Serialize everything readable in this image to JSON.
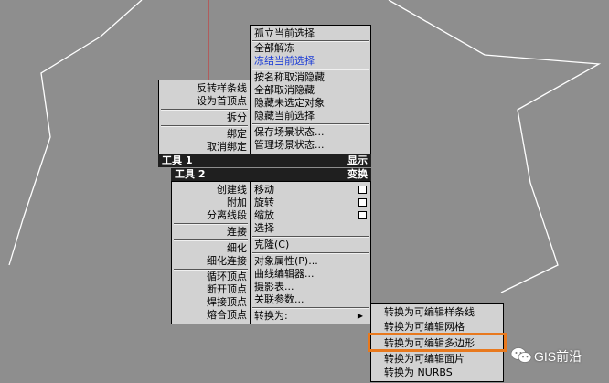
{
  "colors": {
    "viewport_bg": "#8e8e8e",
    "menu_bg": "#d2d2d2",
    "header_bg": "#1f1f1f",
    "header_text": "#ffffff",
    "highlight_text": "#1a3bd6",
    "emphasis_border": "#e8791e",
    "spline_line": "#ffffff",
    "axis_line": "#c83c3c"
  },
  "display_menu": {
    "items": [
      "孤立当前选择",
      "全部解冻",
      "冻结当前选择",
      "按名称取消隐藏",
      "全部取消隐藏",
      "隐藏未选定对象",
      "隐藏当前选择",
      "保存场景状态...",
      "管理场景状态..."
    ]
  },
  "tools1_menu": {
    "items": [
      "反转样条线",
      "设为首顶点",
      "拆分",
      "绑定",
      "取消绑定"
    ]
  },
  "quad_headers": {
    "tools1": "工具 1",
    "display": "显示",
    "tools2": "工具 2",
    "transform": "变换"
  },
  "tools2_menu": {
    "items": [
      "创建线",
      "附加",
      "分离线段",
      "连接",
      "细化",
      "细化连接",
      "循环顶点",
      "断开顶点",
      "焊接顶点",
      "熔合顶点"
    ]
  },
  "transform_menu": {
    "items": [
      "移动",
      "旋转",
      "缩放",
      "选择",
      "克隆(C)",
      "对象属性(P)...",
      "曲线编辑器...",
      "摄影表...",
      "关联参数...",
      "转换为:"
    ],
    "submenu_arrow_icon": "triangle-right-icon"
  },
  "convert_submenu": {
    "items": [
      "转换为可编辑样条线",
      "转换为可编辑网格",
      "转换为可编辑多边形",
      "转换为可编辑面片",
      "转换为 NURBS"
    ],
    "highlighted_index": 2
  },
  "watermark": {
    "icon": "wechat-icon",
    "text": "GIS前沿"
  }
}
